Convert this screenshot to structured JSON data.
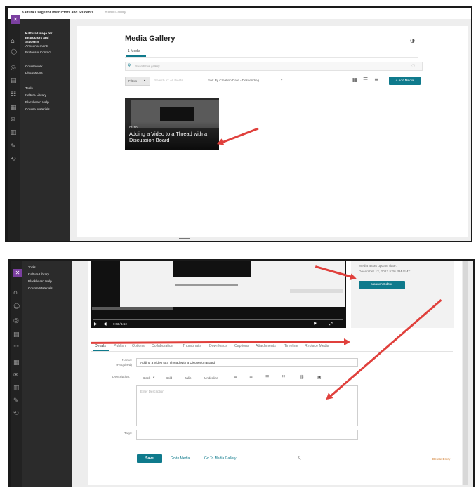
{
  "top": {
    "header_title": "Kaltura Usage for Instructors and Students",
    "header_crumb": "Course Gallery",
    "sidebar": {
      "course_title": "Kaltura Usage for Instructors and Students",
      "items": [
        "Announcements",
        "Professor Contact",
        "Coursework",
        "Discussions",
        "Tools",
        "Kaltura Library",
        "Blackboard Help",
        "Course Materials"
      ]
    },
    "gallery": {
      "title": "Media Gallery",
      "tab": "1 Media",
      "search_placeholder": "Search this gallery",
      "filters_label": "Filters",
      "search_in": "Search In: All Fields",
      "sort": "Sort By Creation Date - Descending",
      "add_media": "+ Add Media",
      "video_duration": "01:10",
      "video_title": "Adding a Video to a Thread with a Discussion Board"
    }
  },
  "bottom": {
    "sidebar_items": [
      "Tools",
      "Kaltura Library",
      "Blackboard Help",
      "Course Materials"
    ],
    "player": {
      "time": "0:03 / 1:10"
    },
    "meta": {
      "updated_label": "Media asset update date:",
      "updated_date": "December 12, 2022 5:26 PM GMT",
      "launch_editor": "Launch Editor"
    },
    "tabs": [
      "Details",
      "Publish",
      "Options",
      "Collaboration",
      "Thumbnails",
      "Downloads",
      "Captions",
      "Attachments",
      "Timeline",
      "Replace Media"
    ],
    "form": {
      "name_label": "Name: (Required)",
      "name_value": "Adding a Video to a Thread with a Discussion Board",
      "description_label": "Description:",
      "toolbar": [
        "Block",
        "Bold",
        "Italic",
        "Underline"
      ],
      "description_placeholder": "Enter Description",
      "tags_label": "Tags:",
      "save": "Save",
      "go_to_media": "Go to Media",
      "go_to_gallery": "Go To Media Gallery",
      "delete": "Delete Entry"
    }
  },
  "colors": {
    "accent": "#0f7a8c",
    "arrow": "#e0403c",
    "close": "#7b3fa0"
  }
}
